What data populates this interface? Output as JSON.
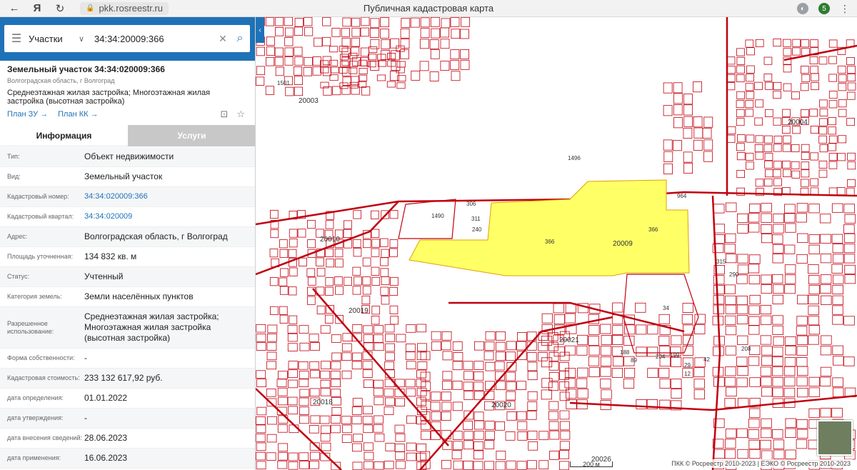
{
  "browser": {
    "url": "pkk.rosreestr.ru",
    "title": "Публичная кадастровая карта",
    "ext_badge": "5"
  },
  "search": {
    "type": "Участки",
    "query": "34:34:20009:366"
  },
  "object": {
    "title": "Земельный участок 34:34:020009:366",
    "region": "Волгоградская область, г Волгоград",
    "usage": "Среднеэтажная жилая застройка; Многоэтажная жилая застройка (высотная застройка)",
    "plan_zu": "План ЗУ →",
    "plan_kk": "План КК →"
  },
  "tabs": {
    "info": "Информация",
    "services": "Услуги"
  },
  "rows": [
    {
      "k": "Тип:",
      "v": "Объект недвижимости"
    },
    {
      "k": "Вид:",
      "v": "Земельный участок"
    },
    {
      "k": "Кадастровый номер:",
      "v": "34:34:020009:366"
    },
    {
      "k": "Кадастровый квартал:",
      "v": "34:34:020009"
    },
    {
      "k": "Адрес:",
      "v": "Волгоградская область, г Волгоград"
    },
    {
      "k": "Площадь уточненная:",
      "v": "134 832 кв. м"
    },
    {
      "k": "Статус:",
      "v": "Учтенный"
    },
    {
      "k": "Категория земель:",
      "v": "Земли населённых пунктов"
    },
    {
      "k": "Разрешенное использование:",
      "v": "Среднеэтажная жилая застройка; Многоэтажная жилая застройка (высотная застройка)"
    },
    {
      "k": "Форма собственности:",
      "v": "-"
    },
    {
      "k": "Кадастровая стоимость:",
      "v": "233 132 617,92 руб."
    },
    {
      "k": "дата определения:",
      "v": "01.01.2022"
    },
    {
      "k": "дата утверждения:",
      "v": "-"
    },
    {
      "k": "дата внесения сведений:",
      "v": "28.06.2023"
    },
    {
      "k": "дата применения:",
      "v": "16.06.2023"
    }
  ],
  "map": {
    "highlight_color": "#ffff66",
    "boundary_color": "#c0000f",
    "quarters": [
      "20003",
      "20004",
      "20009",
      "20010",
      "20019",
      "20018",
      "20020",
      "20021",
      "20026"
    ],
    "parcels": [
      "366",
      "366",
      "1490",
      "306",
      "311",
      "240",
      "964",
      "34",
      "1496",
      "1501",
      "188",
      "89",
      "204",
      "199",
      "29",
      "12",
      "42",
      "208",
      "290",
      "315"
    ],
    "attribution": "ПКК © Росреестр 2010-2023 | ЕЭКО © Росреестр 2010-2023",
    "scale": "200 м"
  }
}
